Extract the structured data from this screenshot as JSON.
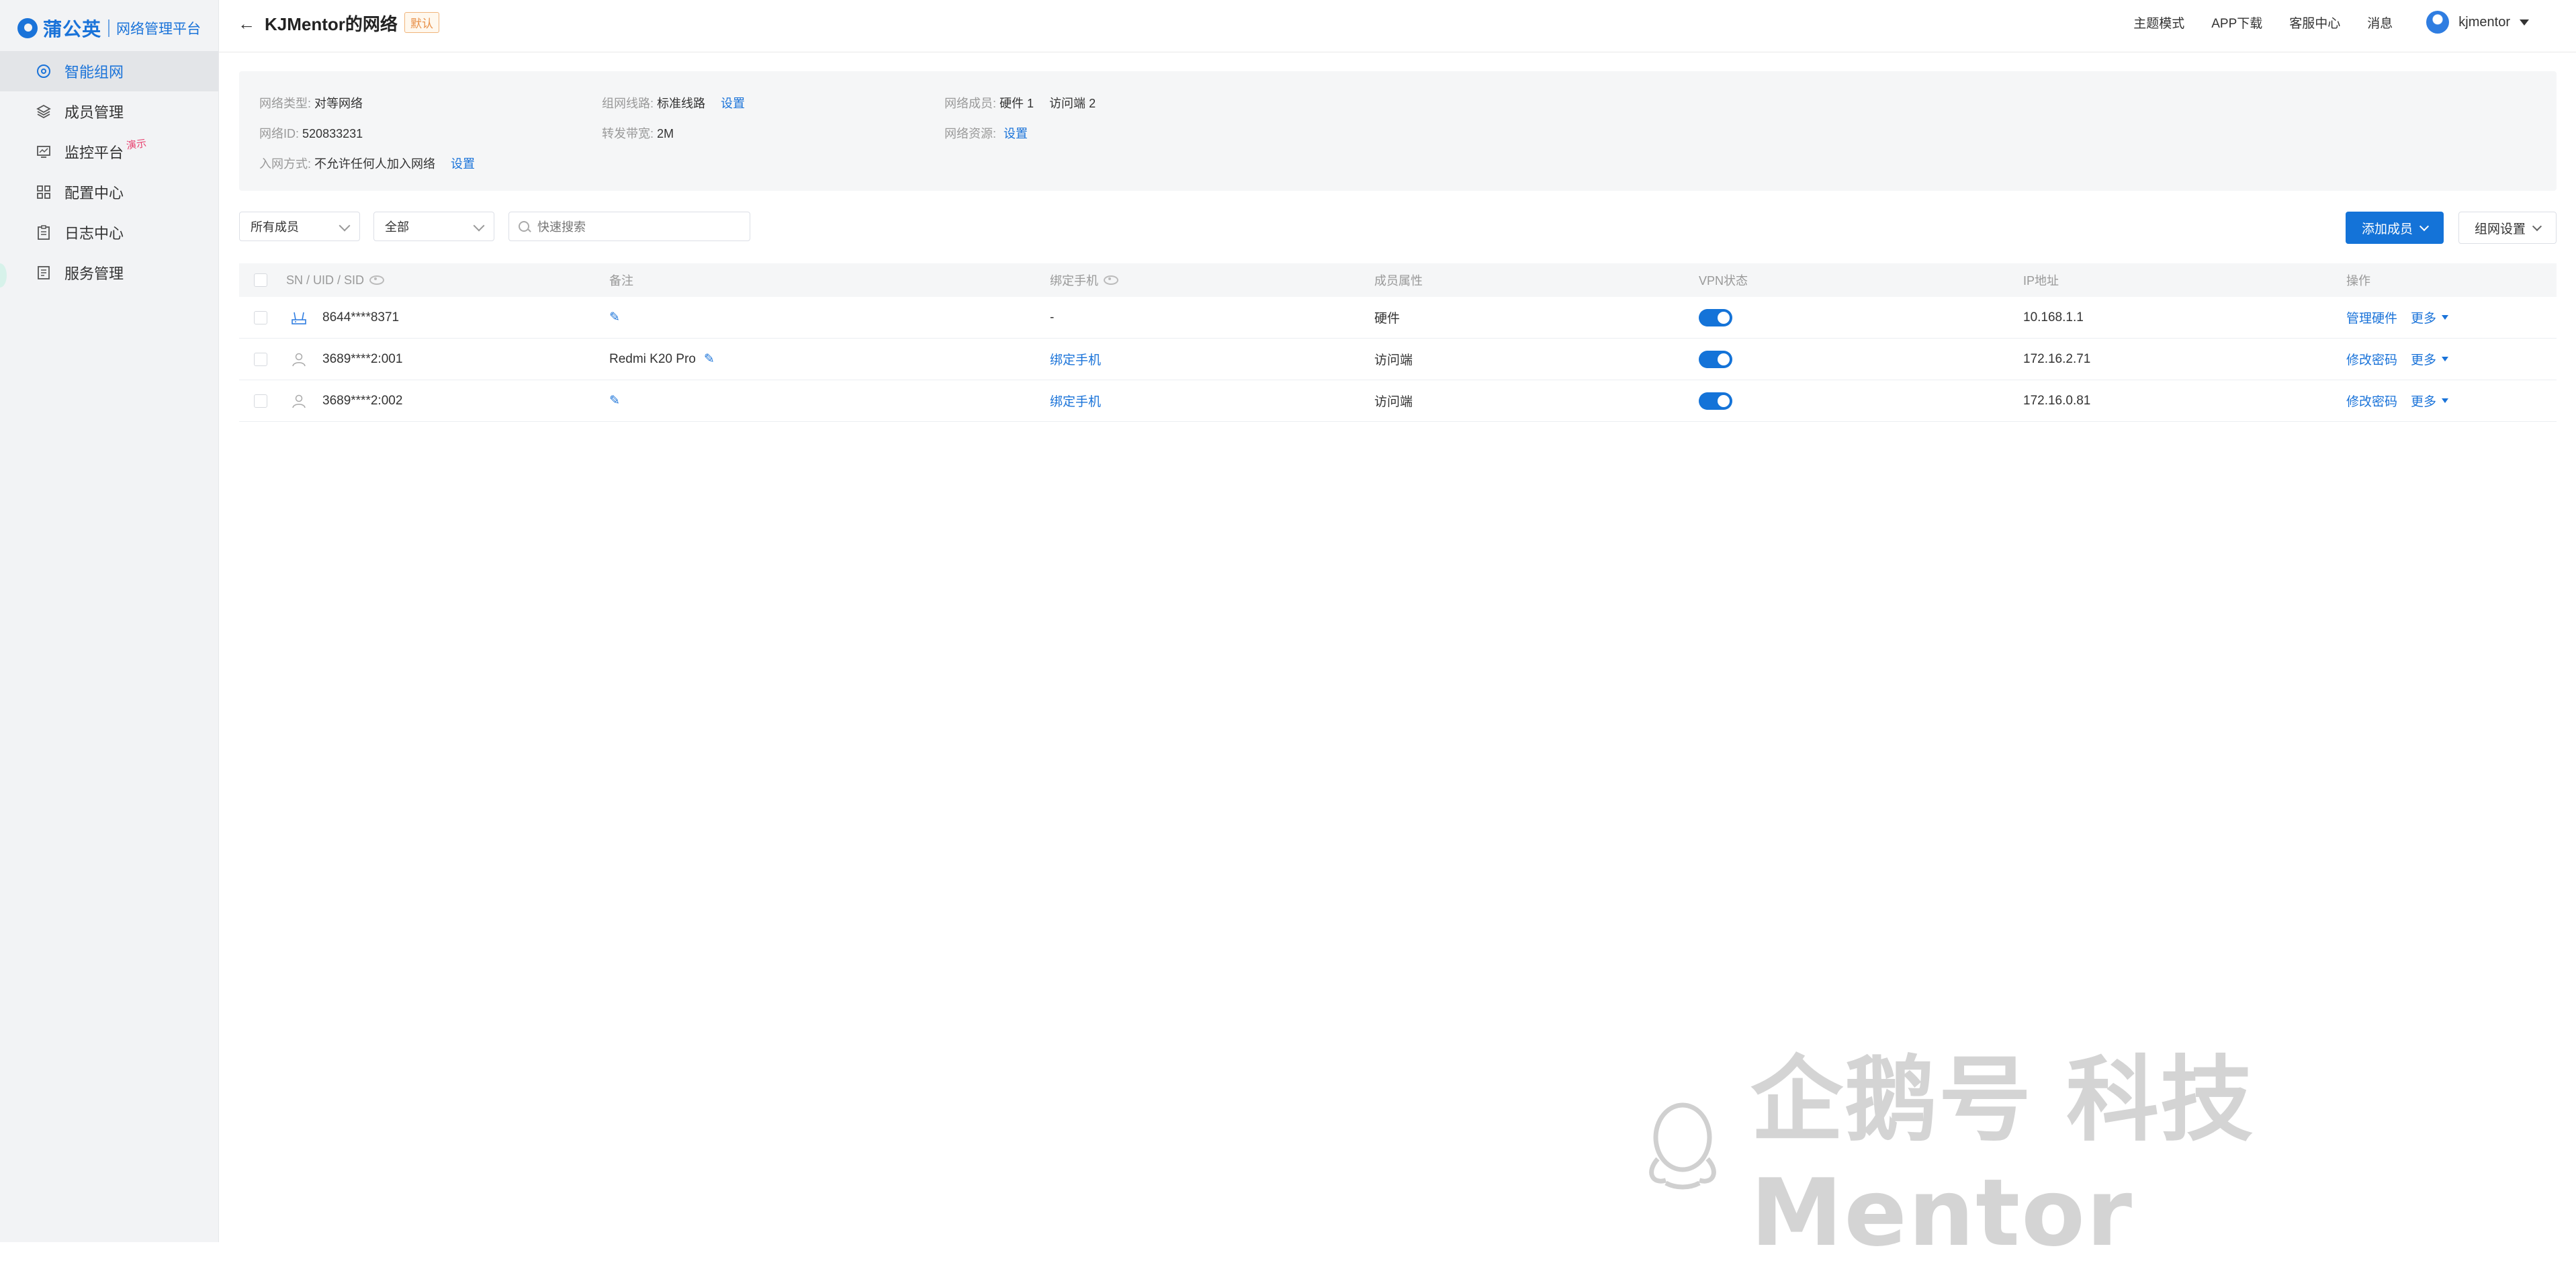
{
  "brand": {
    "name": "蒲公英",
    "subtitle": "网络管理平台"
  },
  "sidebar": {
    "items": [
      {
        "label": "智能组网",
        "icon": "network-icon",
        "active": true
      },
      {
        "label": "成员管理",
        "icon": "layers-icon"
      },
      {
        "label": "监控平台",
        "icon": "monitor-icon",
        "badge": "演示"
      },
      {
        "label": "配置中心",
        "icon": "grid-icon"
      },
      {
        "label": "日志中心",
        "icon": "clipboard-icon"
      },
      {
        "label": "服务管理",
        "icon": "document-icon"
      }
    ]
  },
  "header": {
    "title": "KJMentor的网络",
    "tag": "默认",
    "links": [
      "主题模式",
      "APP下载",
      "客服中心",
      "消息"
    ],
    "user": "kjmentor"
  },
  "info": {
    "network_type_label": "网络类型:",
    "network_type_value": "对等网络",
    "network_id_label": "网络ID:",
    "network_id_value": "520833231",
    "join_label": "入网方式:",
    "join_value": "不允许任何人加入网络",
    "join_link": "设置",
    "route_label": "组网线路:",
    "route_value": "标准线路",
    "route_link": "设置",
    "bandwidth_label": "转发带宽:",
    "bandwidth_value": "2M",
    "members_label": "网络成员:",
    "members_hw": "硬件 1",
    "members_access": "访问端 2",
    "resources_label": "网络资源:",
    "resources_link": "设置"
  },
  "toolbar": {
    "filter_member": "所有成员",
    "filter_all": "全部",
    "search_placeholder": "快速搜索",
    "add_member": "添加成员",
    "network_settings": "组网设置"
  },
  "table": {
    "headers": {
      "sn": "SN / UID / SID",
      "note": "备注",
      "phone": "绑定手机",
      "attr": "成员属性",
      "vpn": "VPN状态",
      "ip": "IP地址",
      "ops": "操作"
    },
    "rows": [
      {
        "id": "8644****8371",
        "type": "router-icon",
        "note": "",
        "phone": "-",
        "attr": "硬件",
        "vpn": true,
        "ip": "10.168.1.1",
        "op": "管理硬件",
        "more": "更多"
      },
      {
        "id": "3689****2:001",
        "type": "user-icon",
        "note": "Redmi K20 Pro",
        "phone": "绑定手机",
        "attr": "访问端",
        "vpn": true,
        "ip": "172.16.2.71",
        "op": "修改密码",
        "more": "更多"
      },
      {
        "id": "3689****2:002",
        "type": "user-icon",
        "note": "",
        "phone": "绑定手机",
        "attr": "访问端",
        "vpn": true,
        "ip": "172.16.0.81",
        "op": "修改密码",
        "more": "更多"
      }
    ]
  },
  "watermark": "企鹅号 科技Mentor"
}
